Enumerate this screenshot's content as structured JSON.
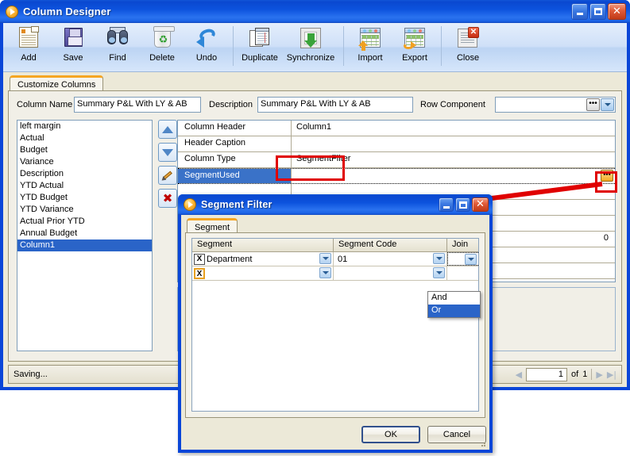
{
  "main_window": {
    "title": "Column Designer",
    "window_controls": {
      "minimize": "_",
      "maximize": "□",
      "close": "✕"
    },
    "toolbar": [
      {
        "label": "Add",
        "icon": "add-document-icon"
      },
      {
        "label": "Save",
        "icon": "floppy-disk-icon"
      },
      {
        "label": "Find",
        "icon": "binoculars-icon"
      },
      {
        "label": "Delete",
        "icon": "recycle-bin-icon"
      },
      {
        "label": "Undo",
        "icon": "undo-arrow-icon"
      },
      {
        "label": "Duplicate",
        "icon": "duplicate-pages-icon"
      },
      {
        "label": "Synchronize",
        "icon": "synchronize-icon"
      },
      {
        "label": "Import",
        "icon": "import-grid-icon"
      },
      {
        "label": "Export",
        "icon": "export-grid-icon"
      },
      {
        "label": "Close",
        "icon": "close-window-icon"
      }
    ],
    "tab": {
      "label": "Customize Columns"
    },
    "fields": {
      "column_name_label": "Column Name",
      "column_name_value": "Summary P&L With LY & AB",
      "description_label": "Description",
      "description_value": "Summary P&L With LY & AB",
      "row_component_label": "Row Component",
      "row_component_value": "",
      "row_component_ellipsis": "•••"
    },
    "column_list": [
      "left margin",
      "Actual",
      "Budget",
      "Variance",
      "Description",
      "YTD Actual",
      "YTD Budget",
      "YTD Variance",
      "Actual Prior YTD",
      "Annual Budget",
      "Column1"
    ],
    "column_list_selected": "Column1",
    "side_buttons": [
      {
        "name": "move-up",
        "icon": "triangle-up-icon"
      },
      {
        "name": "move-down",
        "icon": "triangle-down-icon"
      },
      {
        "name": "edit",
        "icon": "pencil-icon"
      },
      {
        "name": "delete",
        "icon": "red-x-icon"
      }
    ],
    "property_grid": {
      "rows": [
        {
          "name": "Column Header",
          "value": "Column1",
          "selected": false,
          "align": "left"
        },
        {
          "name": "Header Caption",
          "value": "",
          "selected": false,
          "align": "left"
        },
        {
          "name": "Column Type",
          "value": "SegmentFilter",
          "selected": false,
          "align": "left"
        },
        {
          "name": "SegmentUsed",
          "value": "",
          "selected": true,
          "align": "left",
          "ellipsis": "•••"
        },
        {
          "name": "",
          "value": "",
          "selected": false,
          "align": "left"
        },
        {
          "name": "",
          "value": "",
          "selected": false,
          "align": "left"
        },
        {
          "name": "",
          "value": "",
          "selected": false,
          "align": "left"
        },
        {
          "name": "",
          "value": "0",
          "selected": false,
          "align": "right"
        },
        {
          "name": "",
          "value": "",
          "selected": false,
          "align": "left"
        },
        {
          "name": "",
          "value": "",
          "selected": false,
          "align": "left"
        }
      ]
    },
    "status_bar": {
      "status_text": "Saving...",
      "pager": {
        "first": "◀",
        "prev": "◀",
        "page_value": "1",
        "of_label": "of",
        "total_pages": "1",
        "next": "▶",
        "last": "▶|"
      }
    }
  },
  "segment_dialog": {
    "title": "Segment Filter",
    "window_controls": {
      "minimize": "_",
      "maximize": "□",
      "close": "✕"
    },
    "tab": {
      "label": "Segment"
    },
    "grid": {
      "headers": [
        "Segment",
        "Segment Code",
        "Join"
      ],
      "rows": [
        {
          "x_button": "X",
          "segment": "Department",
          "segment_code": "01",
          "join": ""
        },
        {
          "x_button": "X",
          "segment": "",
          "segment_code": "",
          "join": ""
        }
      ]
    },
    "join_dropdown": {
      "open": true,
      "options": [
        "And",
        "Or"
      ],
      "selected": "Or"
    },
    "buttons": {
      "ok": "OK",
      "cancel": "Cancel"
    }
  },
  "annotations": {
    "highlight_color": "#e00000",
    "rect_labels": [
      "column-type-value-highlight",
      "segment-used-ellipsis-highlight"
    ]
  }
}
